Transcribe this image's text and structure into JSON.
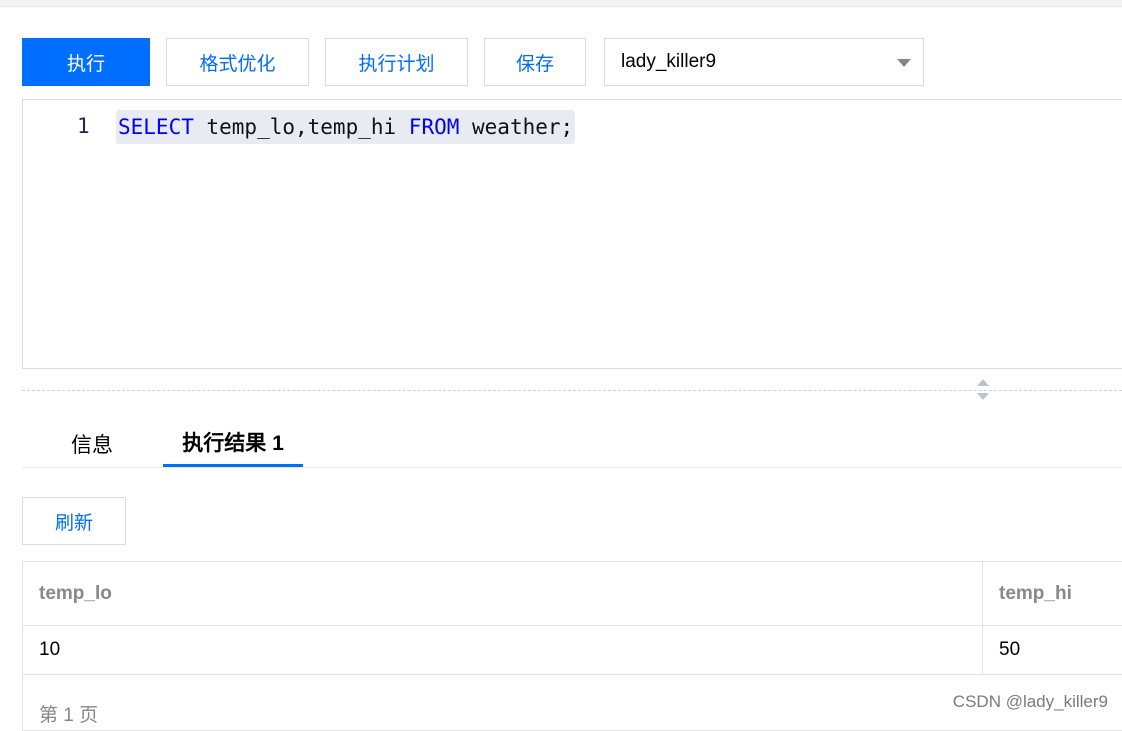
{
  "toolbar": {
    "execute_label": "执行",
    "format_label": "格式优化",
    "plan_label": "执行计划",
    "save_label": "保存",
    "database_select_value": "lady_killer9"
  },
  "editor": {
    "line_numbers": [
      "1"
    ],
    "code_tokens": [
      "SELECT",
      " temp_lo,temp_hi ",
      "FROM",
      " weather;"
    ]
  },
  "tabs": [
    {
      "label": "信息",
      "active": false
    },
    {
      "label": "执行结果 1",
      "active": true
    }
  ],
  "results": {
    "refresh_label": "刷新",
    "columns": [
      "temp_lo",
      "temp_hi"
    ],
    "rows": [
      [
        "10",
        "50"
      ]
    ],
    "pager_text": "第 1 页"
  },
  "watermark": "CSDN @lady_killer9",
  "colors": {
    "accent": "#006eff",
    "keyword": "#0000ff"
  }
}
